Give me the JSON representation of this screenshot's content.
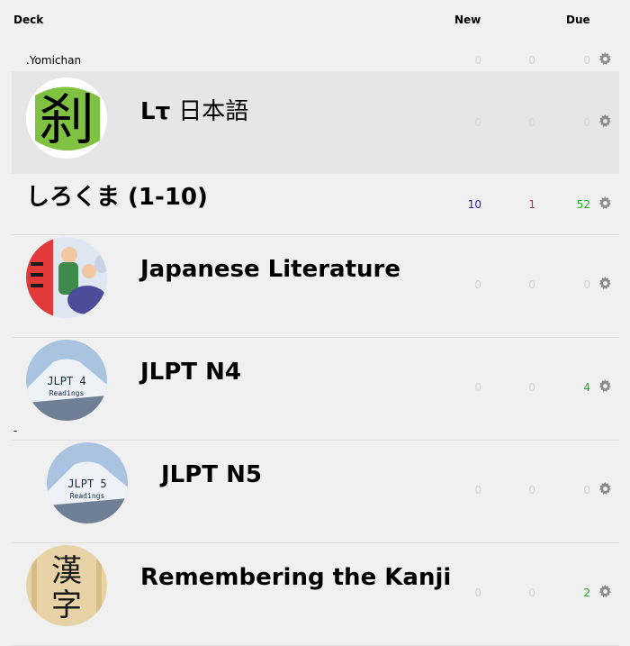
{
  "header": {
    "deck": "Deck",
    "new": "New",
    "due": "Due"
  },
  "yomichan_label": ".Yomichan",
  "dash_label": "-",
  "decks": [
    {
      "name_latin": "Lτ",
      "name_jp": "日本語",
      "avatar_text": "刹",
      "new": "0",
      "learn": "0",
      "due": "0"
    },
    {
      "name": "しろくま (1-10)",
      "new": "10",
      "learn": "1",
      "due": "52"
    },
    {
      "name": "Japanese Literature",
      "new": "0",
      "learn": "0",
      "due": "0"
    },
    {
      "name": "JLPT N4",
      "avatar_text": "JLPT 4",
      "avatar_sub": "Readings",
      "new": "0",
      "learn": "0",
      "due": "4"
    },
    {
      "name": "JLPT N5",
      "avatar_text": "JLPT 5",
      "avatar_sub": "Readings",
      "new": "0",
      "learn": "0",
      "due": "0"
    },
    {
      "name": "Remembering the Kanji",
      "avatar_text": "漢字",
      "new": "0",
      "learn": "0",
      "due": "2"
    }
  ],
  "summary": {
    "yomichan_new": "0",
    "yomichan_learn": "0",
    "yomichan_due": "0"
  },
  "colors": {
    "new": "#2222aa",
    "learn": "#cc3333",
    "due": "#22aa22",
    "zero": "#d4d4d4",
    "highlight": "#e6e6e6"
  },
  "icons": {
    "options": "gear-icon"
  }
}
